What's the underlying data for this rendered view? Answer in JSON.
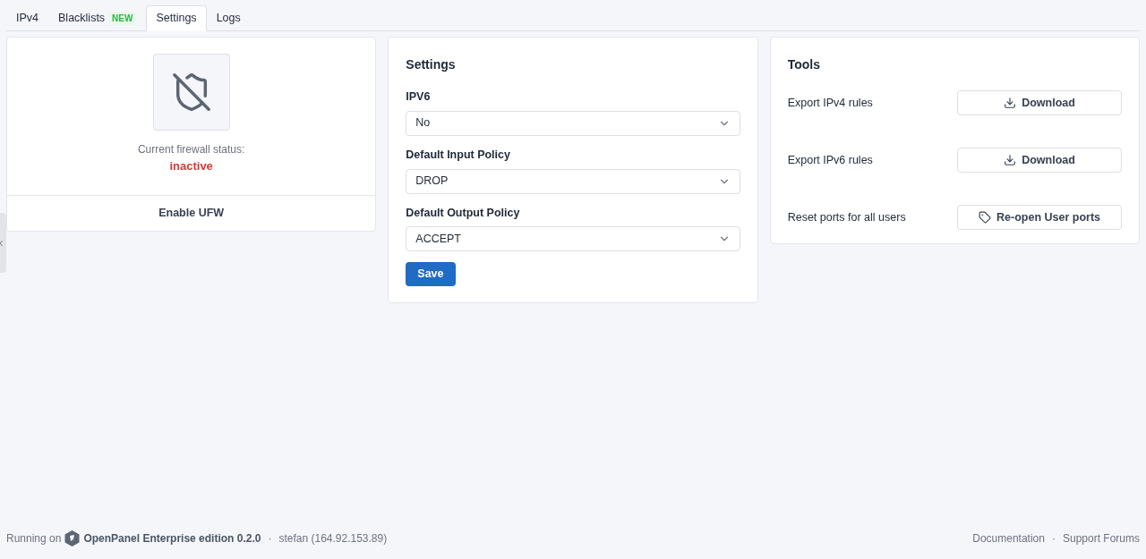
{
  "tabs": [
    {
      "label": "IPv4",
      "selected": false
    },
    {
      "label": "Blacklists",
      "badge": "NEW",
      "selected": false
    },
    {
      "label": "Settings",
      "selected": true
    },
    {
      "label": "Logs",
      "selected": false
    }
  ],
  "status_card": {
    "status_label": "Current firewall status:",
    "status": "inactive",
    "active": false,
    "action": "Enable UFW"
  },
  "settings_card": {
    "title": "Settings",
    "fields": [
      {
        "label": "IPV6",
        "value": "No"
      },
      {
        "label": "Default Input Policy",
        "value": "DROP"
      },
      {
        "label": "Default Output Policy",
        "value": "ACCEPT"
      }
    ],
    "save": "Save"
  },
  "tools_card": {
    "title": "Tools",
    "rows": [
      {
        "label": "Export IPv4 rules",
        "button": "Download",
        "kind": "download"
      },
      {
        "label": "Export IPv6 rules",
        "button": "Download",
        "kind": "download"
      },
      {
        "label": "Reset ports for all users",
        "button": "Re-open User ports",
        "kind": "tag"
      }
    ]
  },
  "footer": {
    "left": [
      {
        "kind": "text",
        "text": "Running on"
      },
      {
        "kind": "brand",
        "text": "OpenPanel Enterprise edition 0.2.0"
      },
      {
        "kind": "separator",
        "text": "·"
      },
      {
        "kind": "text",
        "text": "stefan (164.92.153.89)"
      }
    ],
    "right": [
      {
        "kind": "link",
        "text": "Documentation"
      },
      {
        "kind": "separator",
        "text": "·"
      },
      {
        "kind": "link",
        "text": "Support Forums"
      }
    ]
  }
}
